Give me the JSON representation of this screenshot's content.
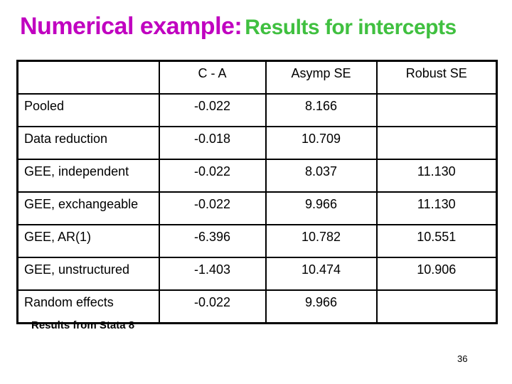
{
  "title": {
    "part1": "Numerical example:",
    "part2": "Results for intercepts",
    "colors": {
      "part1": "#c000c0",
      "part2": "#40c040"
    }
  },
  "table": {
    "columns": [
      "",
      "C - A",
      "Asymp SE",
      "Robust SE"
    ],
    "rows": [
      {
        "label": "Pooled",
        "c_minus_a": "-0.022",
        "asymp_se": "8.166",
        "robust_se": ""
      },
      {
        "label": "Data reduction",
        "c_minus_a": "-0.018",
        "asymp_se": "10.709",
        "robust_se": ""
      },
      {
        "label": "GEE, independent",
        "c_minus_a": "-0.022",
        "asymp_se": "8.037",
        "robust_se": "11.130"
      },
      {
        "label": "GEE, exchangeable",
        "c_minus_a": "-0.022",
        "asymp_se": "9.966",
        "robust_se": "11.130"
      },
      {
        "label": "GEE, AR(1)",
        "c_minus_a": "-6.396",
        "asymp_se": "10.782",
        "robust_se": "10.551"
      },
      {
        "label": "GEE, unstructured",
        "c_minus_a": "-1.403",
        "asymp_se": "10.474",
        "robust_se": "10.906"
      },
      {
        "label": "Random effects",
        "c_minus_a": "-0.022",
        "asymp_se": "9.966",
        "robust_se": ""
      }
    ]
  },
  "footnote": "Results from Stata 8",
  "page_number": "36"
}
